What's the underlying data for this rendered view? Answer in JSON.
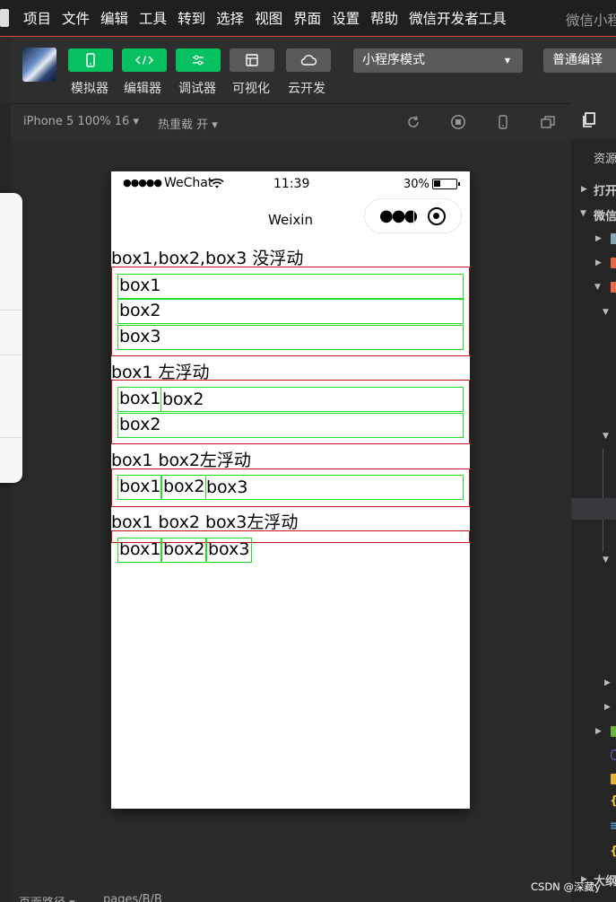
{
  "menubar": {
    "items": [
      "项目",
      "文件",
      "编辑",
      "工具",
      "转到",
      "选择",
      "视图",
      "界面",
      "设置",
      "帮助",
      "微信开发者工具"
    ],
    "window_title": "微信小程序"
  },
  "toolbar": {
    "buttons": [
      {
        "label": "模拟器",
        "icon": "phone-icon"
      },
      {
        "label": "编辑器",
        "icon": "code-icon"
      },
      {
        "label": "调试器",
        "icon": "debug-icon"
      },
      {
        "label": "可视化",
        "icon": "layout-icon"
      },
      {
        "label": "云开发",
        "icon": "cloud-icon"
      }
    ],
    "mode": "小程序模式",
    "compile": "普通编译"
  },
  "simulator": {
    "device": "iPhone 5 100% 16 ▾",
    "hot_reload": "热重载 开 ▾"
  },
  "phone": {
    "signal": "●●●●●",
    "carrier": "WeChat",
    "time": "11:39",
    "battery": "30%",
    "battery_level": 0.3,
    "nav_title": "Weixin",
    "sections": [
      {
        "title": "box1,box2,box3 没浮动",
        "boxes": [
          "box1",
          "box2",
          "box3"
        ]
      },
      {
        "title": "box1 左浮动",
        "boxes": [
          "box1",
          "box2",
          "box2"
        ]
      },
      {
        "title": "box1 box2左浮动",
        "boxes": [
          "box1",
          "box2",
          "box3"
        ]
      },
      {
        "title": "box1 box2 box3左浮动",
        "boxes": [
          "box1",
          "box2",
          "box3"
        ]
      }
    ]
  },
  "right_panel": {
    "heading": "资源",
    "item_open": "打开",
    "item_wechat": "微信",
    "item_outline": "大纲"
  },
  "bottombar": {
    "path_label": "页面路径 ▾",
    "path": "pages/B/B"
  },
  "watermark": "CSDN @深藏y",
  "colors": {
    "accent_green": "#07c160",
    "box_border": "#22dd22",
    "container_border": "#c8101e"
  }
}
